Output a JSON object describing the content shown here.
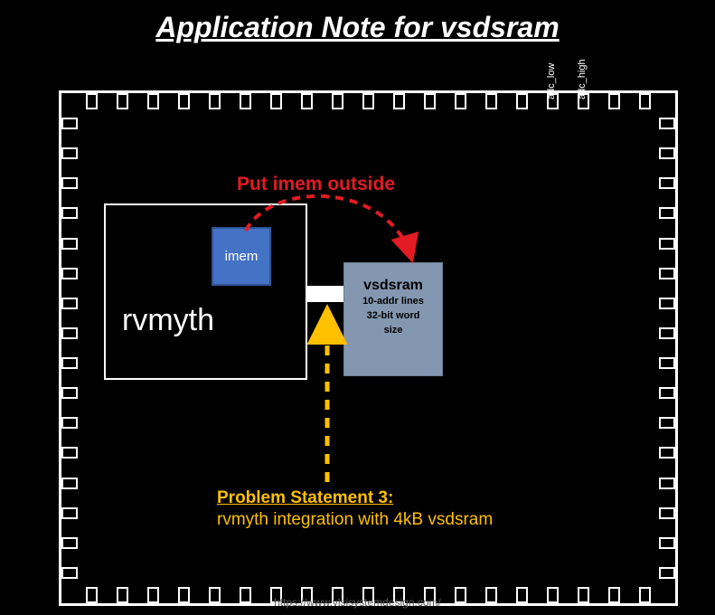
{
  "title": "Application Note for vsdsram",
  "pin_labels": {
    "adc_low": "adc_low",
    "adc_high": "adc_high"
  },
  "rvmyth": {
    "label": "rvmyth"
  },
  "imem": {
    "label": "imem"
  },
  "vsdsram": {
    "title": "vsdsram",
    "line1": "10-addr lines",
    "line2": "32-bit word",
    "line3": "size"
  },
  "annotation": {
    "put_outside": "Put imem outside"
  },
  "problem": {
    "heading": "Problem Statement 3:",
    "text": "rvmyth integration with 4kB vsdsram"
  },
  "footer": {
    "url": "https://www.vlsisystemdesign.com/"
  }
}
